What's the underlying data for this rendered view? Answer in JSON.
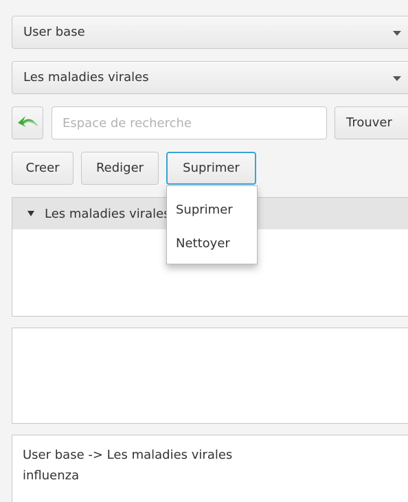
{
  "combo_user": {
    "selected": "User base"
  },
  "combo_category": {
    "selected": "Les maladies virales"
  },
  "search": {
    "placeholder": "Espace de recherche",
    "value": ""
  },
  "buttons": {
    "find": "Trouver",
    "create": "Creer",
    "edit": "Rediger",
    "delete": "Suprimer"
  },
  "tree": {
    "root_label": "Les maladies virales"
  },
  "context_menu": {
    "items": [
      "Suprimer",
      "Nettoyer"
    ]
  },
  "output": {
    "lines": [
      "User base -> Les maladies virales",
      "influenza"
    ]
  },
  "icons": {
    "back": "back-arrow-icon",
    "dropdown": "chevron-down-icon",
    "tree_expand": "triangle-down-icon"
  },
  "colors": {
    "focus_border": "#39a2d7",
    "back_arrow": "#3caa3c",
    "tree_header": "#e4e4e4"
  }
}
